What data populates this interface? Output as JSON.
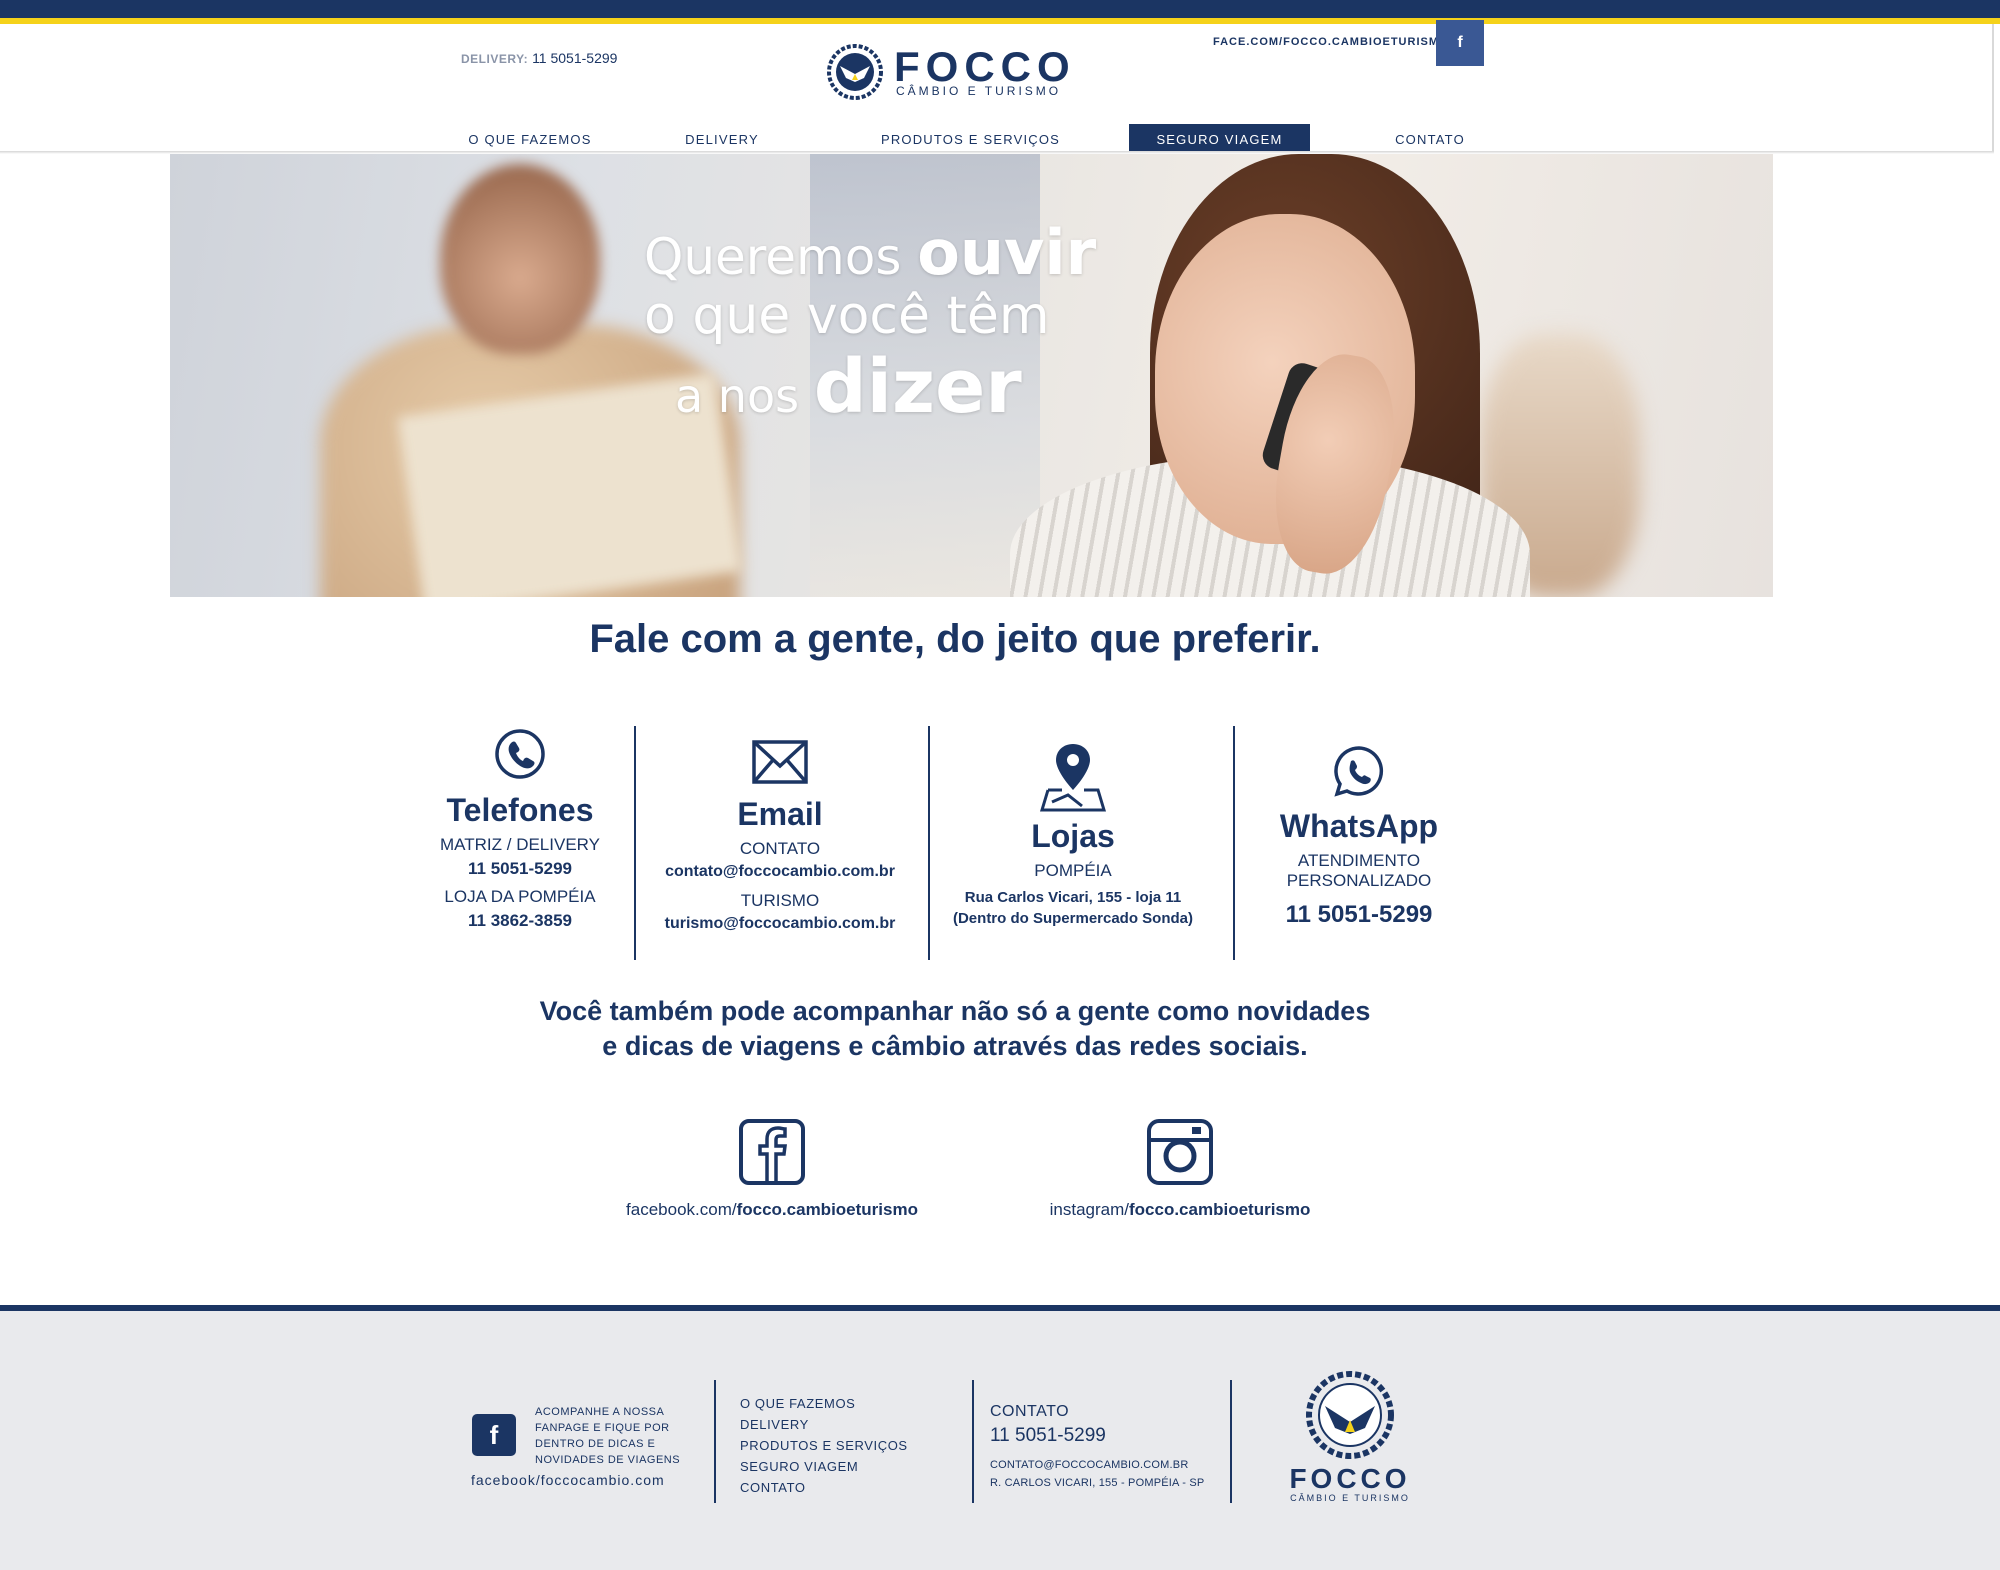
{
  "header": {
    "delivery_label": "DELIVERY:",
    "delivery_phone": "11 5051-5299",
    "brand_name": "FOCCO",
    "brand_sub": "CÂMBIO E TURISMO",
    "face_link": "FACE.COM/FOCCO.CAMBIOETURISMO",
    "facebook_icon": "f"
  },
  "nav": {
    "items": [
      {
        "label": "O QUE FAZEMOS"
      },
      {
        "label": "DELIVERY"
      },
      {
        "label": "PRODUTOS E SERVIÇOS"
      },
      {
        "label": "SEGURO VIAGEM",
        "active": true
      },
      {
        "label": "CONTATO"
      }
    ]
  },
  "hero": {
    "line1_light": "Queremos ",
    "line1_bold": "ouvir",
    "line2": "o que você têm",
    "line3_light": "a nos ",
    "line3_bold": "dizer"
  },
  "main": {
    "title": "Fale com a gente, do jeito que preferir.",
    "phones": {
      "icon": "phone-icon",
      "title": "Telefones",
      "label1": "MATRIZ / DELIVERY",
      "phone1": "11 5051-5299",
      "label2": "LOJA DA POMPÉIA",
      "phone2": "11 3862-3859"
    },
    "email": {
      "icon": "envelope-icon",
      "title": "Email",
      "label1": "CONTATO",
      "email1": "contato@foccocambio.com.br",
      "label2": "TURISMO",
      "email2": "turismo@foccocambio.com.br"
    },
    "stores": {
      "icon": "map-pin-icon",
      "title": "Lojas",
      "label": "POMPÉIA",
      "address1": "Rua Carlos Vicari, 155 - loja 11",
      "address2": "(Dentro do Supermercado Sonda)"
    },
    "whatsapp": {
      "icon": "whatsapp-icon",
      "title": "WhatsApp",
      "label1": "ATENDIMENTO",
      "label2": "PERSONALIZADO",
      "phone": "11 5051-5299"
    },
    "follow_line1": "Você também pode acompanhar não só a gente como novidades",
    "follow_line2": "e dicas de viagens e câmbio através das redes sociais.",
    "facebook_prefix": "facebook.com/",
    "facebook_handle": "focco.cambioeturismo",
    "instagram_prefix": "instagram/",
    "instagram_handle": "focco.cambioeturismo"
  },
  "footer": {
    "fb_text": "ACOMPANHE A NOSSA FANPAGE E FIQUE POR DENTRO DE DICAS E NOVIDADES DE VIAGENS",
    "fb_link": "facebook/foccocambio.com",
    "nav": [
      "O QUE FAZEMOS",
      "DELIVERY",
      "PRODUTOS E SERVIÇOS",
      "SEGURO VIAGEM",
      "CONTATO"
    ],
    "contact_title": "CONTATO",
    "contact_phone": "11 5051-5299",
    "contact_email": "CONTATO@FOCCOCAMBIO.COM.BR",
    "contact_address": "R. CARLOS VICARI, 155 - POMPÉIA - SP",
    "brand_name": "FOCCO",
    "brand_sub": "CÂMBIO E TURISMO"
  },
  "colors": {
    "navy": "#1b3563",
    "yellow": "#f5d21a",
    "facebook": "#3a5894",
    "footer_bg": "#e9eaed"
  }
}
